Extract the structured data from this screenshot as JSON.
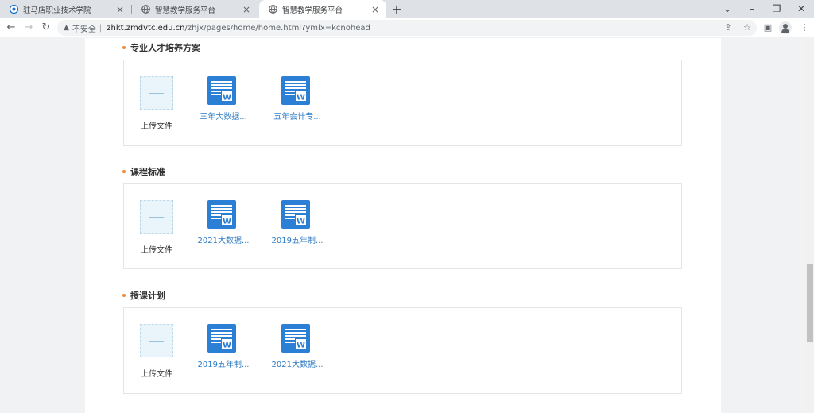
{
  "browser": {
    "tabs": [
      {
        "title": "驻马店职业技术学院",
        "icon": "college-favicon",
        "active": false
      },
      {
        "title": "智慧教学服务平台",
        "icon": "globe-icon",
        "active": false
      },
      {
        "title": "智慧教学服务平台",
        "icon": "globe-icon",
        "active": true
      }
    ],
    "new_tab_symbol": "+",
    "address": {
      "security_label": "不安全",
      "separator": "|",
      "host": "zhkt.zmdvtc.edu.cn",
      "path": "/zhjx/pages/home/home.html?ymlx=kcnohead"
    },
    "window_controls": [
      "⌄",
      "–",
      "❐",
      "✕"
    ]
  },
  "sections": [
    {
      "title": "专业人才培养方案",
      "upload_label": "上传文件",
      "files": [
        {
          "name": "三年大数据...",
          "icon": "word-doc-icon"
        },
        {
          "name": "五年会计专...",
          "icon": "word-doc-icon"
        }
      ]
    },
    {
      "title": "课程标准",
      "upload_label": "上传文件",
      "files": [
        {
          "name": "2021大数据...",
          "icon": "word-doc-icon"
        },
        {
          "name": "2019五年制...",
          "icon": "word-doc-icon"
        }
      ]
    },
    {
      "title": "授课计划",
      "upload_label": "上传文件",
      "files": [
        {
          "name": "2019五年制...",
          "icon": "word-doc-icon"
        },
        {
          "name": "2021大数据...",
          "icon": "word-doc-icon"
        }
      ]
    }
  ],
  "colors": {
    "accent_dot": "#f08a3c",
    "file_link": "#2f7cc6",
    "word_icon": "#2b7fd4"
  }
}
